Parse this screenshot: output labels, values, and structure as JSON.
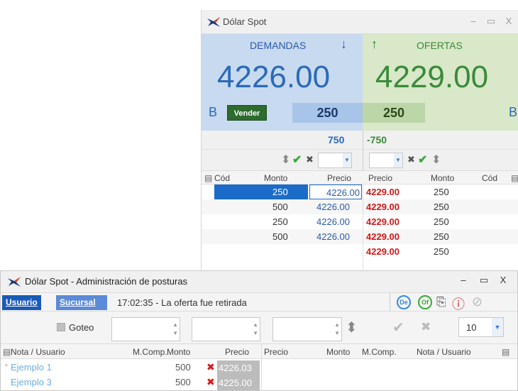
{
  "spot_window": {
    "title": "Dólar Spot",
    "controls": {
      "minimize": "–",
      "maximize": "▭",
      "close": "X"
    },
    "demand": {
      "label": "DEMANDAS",
      "arrow": "↓",
      "price": "4226.00",
      "b_letter": "B",
      "sell_label": "Vender",
      "qty": "250",
      "total": "750"
    },
    "offer": {
      "label": "OFERTAS",
      "arrow": "↑",
      "price": "4229.00",
      "b_letter": "B",
      "qty": "250",
      "total": "-750"
    },
    "columns": {
      "cod_left": "Cód",
      "monto_left": "Monto",
      "precio_left": "Precio",
      "precio_right": "Precio",
      "monto_right": "Monto",
      "cod_right": "Cód"
    },
    "bids": [
      {
        "monto": "250",
        "precio": "4226.00"
      },
      {
        "monto": "500",
        "precio": "4226.00"
      },
      {
        "monto": "250",
        "precio": "4226.00"
      },
      {
        "monto": "500",
        "precio": "4226.00"
      }
    ],
    "asks": [
      {
        "precio": "4229.00",
        "monto": "250"
      },
      {
        "precio": "4229.00",
        "monto": "250"
      },
      {
        "precio": "4229.00",
        "monto": "250"
      },
      {
        "precio": "4229.00",
        "monto": "250"
      },
      {
        "precio": "4229.00",
        "monto": "250"
      }
    ],
    "colors": {
      "demand_bg": "#c8daf0",
      "offer_bg": "#d8e8c8",
      "demand_price": "#2a6ab8",
      "offer_price": "#3a8a3a",
      "ask_text": "#cc1a1a",
      "selected_row": "#1a6cc8"
    }
  },
  "admin_window": {
    "title": "Dólar Spot - Administración de posturas",
    "controls": {
      "minimize": "–",
      "maximize": "▭",
      "close": "X"
    },
    "tabs": {
      "usuario": "Usuario",
      "sucursal": "Sucursal"
    },
    "status": "17:02:35 - La oferta fue retirada",
    "icon_labels": {
      "de": "De",
      "of": "Of"
    },
    "goteo_label": "Goteo",
    "page_size": "10",
    "columns": {
      "nota_left": "Nota / Usuario",
      "mcomp_left": "M.Comp.",
      "monto_left": "Monto",
      "precio_left": "Precio",
      "precio_right": "Precio",
      "monto_right": "Monto",
      "mcomp_right": "M.Comp.",
      "nota_right": "Nota / Usuario"
    },
    "rows": [
      {
        "nota": "Ejemplo 1",
        "monto": "500",
        "precio": "4226.03"
      },
      {
        "nota": "Ejemplo 3",
        "monto": "500",
        "precio": "4225.00"
      }
    ]
  }
}
